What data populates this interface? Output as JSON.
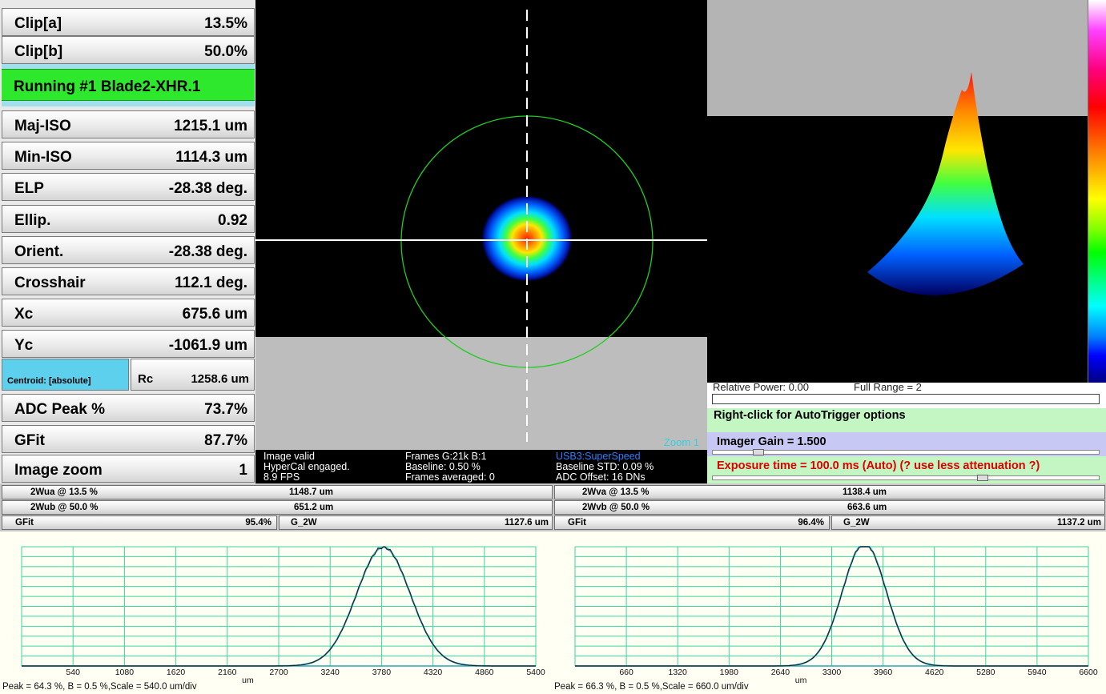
{
  "left_panel": {
    "rows": [
      {
        "label": "Clip[a]",
        "value": "13.5%"
      },
      {
        "label": "Clip[b]",
        "value": "50.0%"
      },
      {
        "label": "Maj-ISO",
        "value": "1215.1 um"
      },
      {
        "label": "Min-ISO",
        "value": "1114.3 um"
      },
      {
        "label": "ELP",
        "value": "-28.38 deg."
      },
      {
        "label": "Ellip.",
        "value": "0.92"
      },
      {
        "label": "Orient.",
        "value": "-28.38 deg."
      },
      {
        "label": "Crosshair",
        "value": "112.1 deg."
      },
      {
        "label": "Xc",
        "value": "675.6 um"
      },
      {
        "label": "Yc",
        "value": "-1061.9 um"
      },
      {
        "label": "ADC Peak %",
        "value": "73.7%"
      },
      {
        "label": "GFit",
        "value": "87.7%"
      },
      {
        "label": "Image zoom",
        "value": "1"
      }
    ],
    "status": "Running #1 Blade2-XHR.1",
    "centroid_button": "Centroid: [absolute]",
    "rc_label": "Rc",
    "rc_value": "1258.6 um"
  },
  "beam2d": {
    "zoom_label": "Zoom 1"
  },
  "info_strip": {
    "col1": [
      "Image valid",
      "HyperCal engaged.",
      "8.9 FPS"
    ],
    "col2": [
      "Frames G:21k B:1",
      "Baseline: 0.50 %",
      "Frames averaged: 0"
    ],
    "col3": [
      "USB3:SuperSpeed",
      "Baseline STD:  0.09 %",
      "ADC Offset: 16 DNs"
    ],
    "usb_color": "#2f7fff"
  },
  "controls": {
    "relative_power": "Relative Power: 0.00",
    "full_range": "Full Range = 2",
    "autotrigger": "Right-click for AutoTrigger options",
    "gain": "Imager Gain = 1.500",
    "exposure": "Exposure time = 100.0 ms (Auto)   (?  use less attenuation ?)"
  },
  "widths": {
    "left": {
      "a_label": "2Wua @ 13.5 %",
      "a_value": "1148.7 um",
      "b_label": "2Wub @ 50.0 %",
      "b_value": "651.2 um",
      "gfit_label": "GFit",
      "gfit_value": "95.4%",
      "g2w_label": "G_2W",
      "g2w_value": "1127.6 um"
    },
    "right": {
      "a_label": "2Wva @ 13.5 %",
      "a_value": "1138.4 um",
      "b_label": "2Wvb @ 50.0 %",
      "b_value": "663.6 um",
      "gfit_label": "GFit",
      "gfit_value": "96.4%",
      "g2w_label": "G_2W",
      "g2w_value": "1137.2 um"
    }
  },
  "chart_data": [
    {
      "type": "line",
      "x_ticks": [
        "540",
        "1080",
        "1620",
        "2160",
        "2700",
        "3240",
        "3780",
        "4320",
        "4860",
        "5400"
      ],
      "xlabel": "um",
      "xlim": [
        0,
        5400
      ],
      "ylim": [
        0,
        100
      ],
      "grid": true,
      "series": [
        {
          "values_peak_pct": 64.3,
          "center_um": 3800,
          "sigma_um": 282
        },
        {
          "values_peak_pct": 64.3,
          "center_um": 3800,
          "sigma_um": 282
        }
      ],
      "caption": "Peak = 64.3 %, B = 0.5 %,Scale = 540.0 um/div",
      "colors": {
        "measured": "#222222",
        "fit": "#29b6d6",
        "grid": "#3ad6a0"
      }
    },
    {
      "type": "line",
      "x_ticks": [
        "660",
        "1320",
        "1980",
        "2640",
        "3300",
        "3960",
        "4620",
        "5280",
        "5940",
        "6600"
      ],
      "xlabel": "um",
      "xlim": [
        0,
        6600
      ],
      "ylim": [
        0,
        100
      ],
      "grid": true,
      "series": [
        {
          "values_peak_pct": 66.3,
          "center_um": 3720,
          "sigma_um": 284
        },
        {
          "values_peak_pct": 66.3,
          "center_um": 3720,
          "sigma_um": 284
        }
      ],
      "caption": "Peak = 66.3 %, B = 0.5 %,Scale = 660.0 um/div",
      "colors": {
        "measured": "#222222",
        "fit": "#29b6d6",
        "grid": "#3ad6a0"
      }
    }
  ]
}
